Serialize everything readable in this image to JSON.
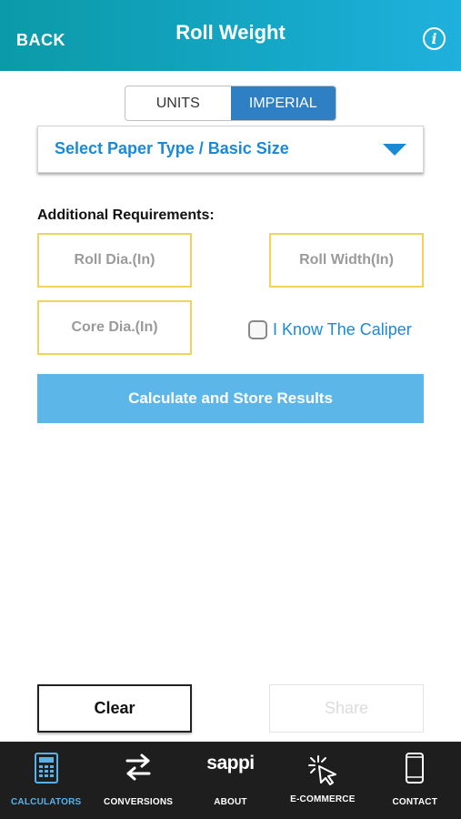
{
  "header": {
    "back_label": "BACK",
    "title": "Roll Weight",
    "info_glyph": "i"
  },
  "units_toggle": {
    "options": [
      "UNITS",
      "IMPERIAL"
    ],
    "selected": "IMPERIAL"
  },
  "paper_select": {
    "label": "Select Paper Type / Basic Size"
  },
  "additional": {
    "heading": "Additional Requirements:",
    "roll_dia_placeholder": "Roll Dia.(In)",
    "roll_width_placeholder": "Roll Width(In)",
    "core_dia_placeholder": "Core Dia.(In)",
    "caliper_label": "I Know The Caliper",
    "caliper_checked": false
  },
  "actions": {
    "calculate_label": "Calculate and Store Results",
    "clear_label": "Clear",
    "share_label": "Share"
  },
  "tabbar": {
    "items": [
      {
        "label": "CALCULATORS",
        "icon": "calculator-icon",
        "active": true
      },
      {
        "label": "CONVERSIONS",
        "icon": "arrows-swap-icon",
        "active": false
      },
      {
        "label": "ABOUT",
        "icon": "sappi-logo",
        "logo_text": "sappi",
        "active": false
      },
      {
        "label": "E-COMMERCE",
        "icon": "cursor-click-icon",
        "active": false
      },
      {
        "label": "CONTACT",
        "icon": "phone-icon",
        "active": false
      }
    ]
  },
  "colors": {
    "header_start": "#0b9aa8",
    "header_end": "#1fb1dc",
    "accent_blue": "#1a8ad4",
    "button_blue": "#5cb7e8",
    "field_border": "#f3d35a",
    "tab_active": "#57b2ec",
    "tabbar_bg": "#1e1e1e"
  }
}
